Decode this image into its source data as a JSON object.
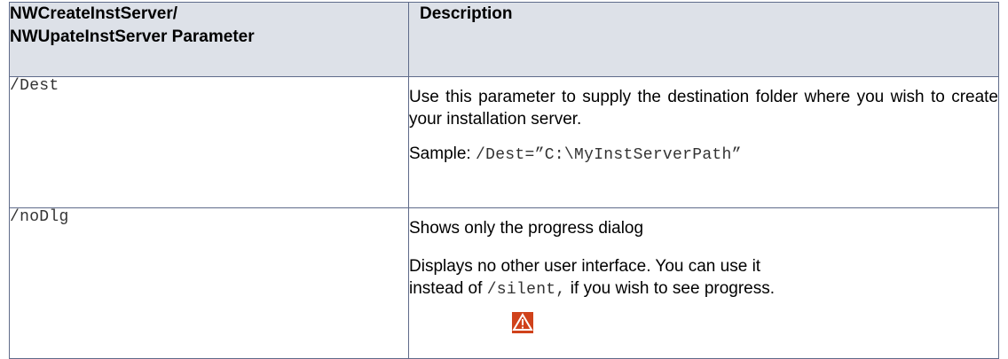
{
  "table": {
    "header": {
      "param_col_line1": "NWCreateInstServer/",
      "param_col_line2": "NWUpateInstServer Parameter",
      "desc_col": "Description"
    },
    "rows": [
      {
        "param": "/Dest",
        "desc": "Use this parameter to supply the destination folder where you wish to create your installation server.",
        "sample_label": "Sample:",
        "sample_value": "/Dest=”C:\\MyInstServerPath”"
      },
      {
        "param": "/noDlg",
        "desc_line1": "Shows only the progress dialog",
        "desc_line2a": "Displays no other user interface. You can use it",
        "desc_line2b": "instead of",
        "desc_code": "/silent,",
        "desc_line2c": "if you wish to see progress.",
        "icon": "warning-icon"
      }
    ]
  },
  "colors": {
    "border": "#5f6b8a",
    "header_bg": "#dde1e8",
    "warning_red": "#d0421b"
  }
}
